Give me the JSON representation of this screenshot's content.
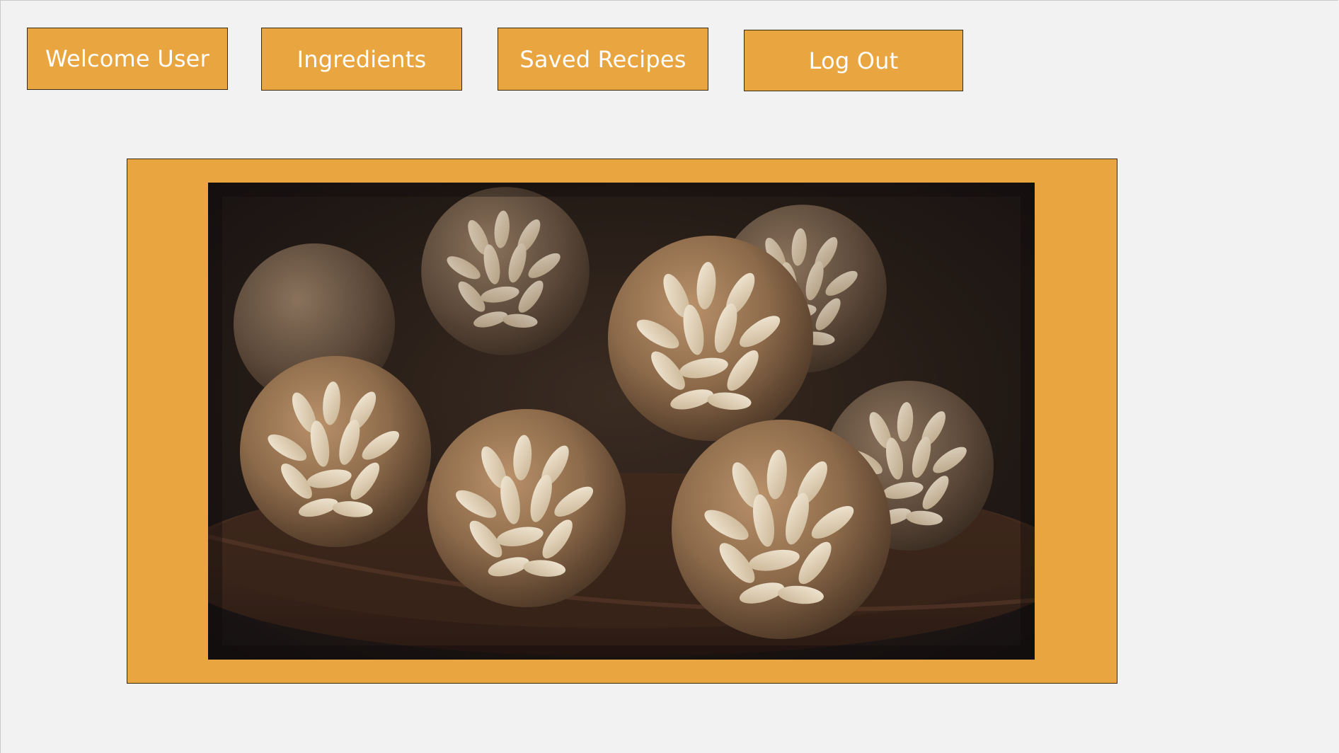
{
  "nav": {
    "welcome_label": "Welcome User",
    "ingredients_label": "Ingredients",
    "saved_recipes_label": "Saved Recipes",
    "logout_label": "Log Out"
  },
  "theme": {
    "accent": "#e9a540",
    "background": "#f2f2f2",
    "border": "#3a2a10",
    "button_text": "#ffffff"
  },
  "hero": {
    "image_subject": "pine-nut-cookie-balls-photo"
  }
}
